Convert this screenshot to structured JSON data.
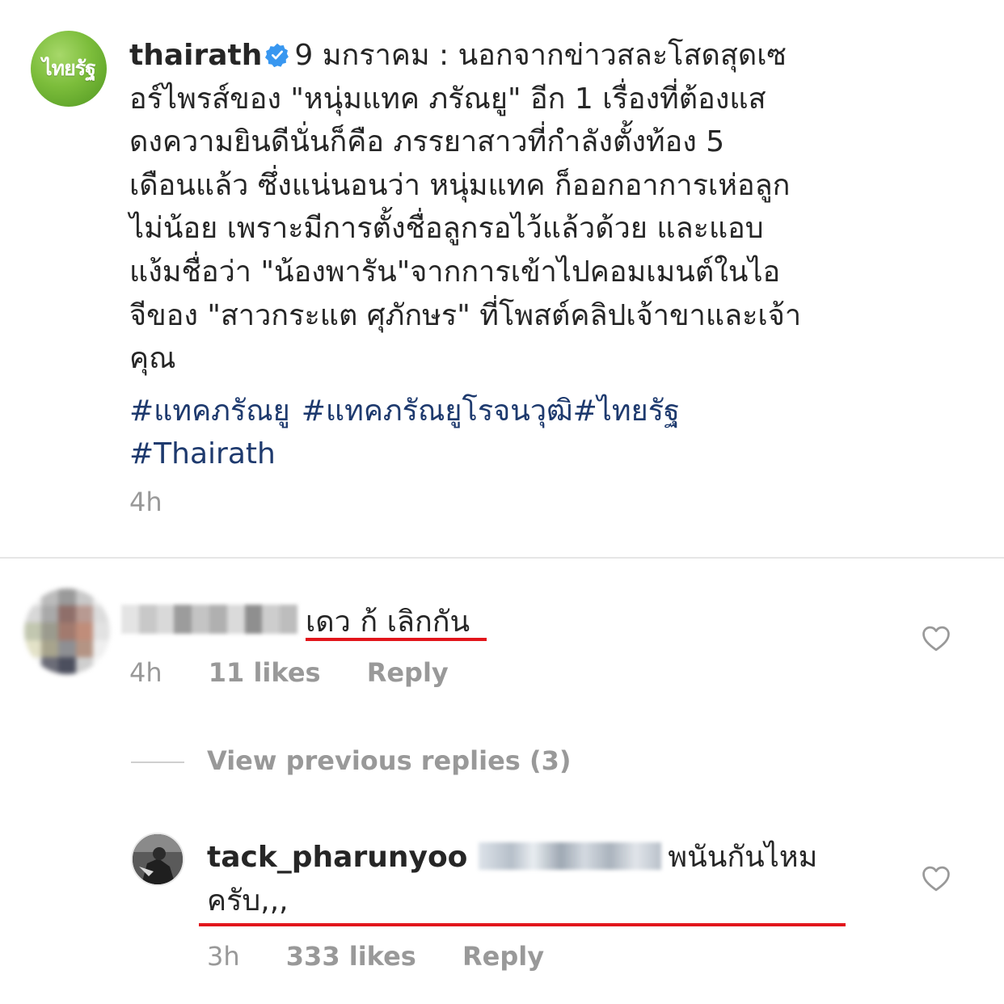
{
  "post": {
    "avatar_logo_text": "ไทยรัฐ",
    "username": "thairath",
    "verified_icon": "verified-badge-icon",
    "caption_lines": [
      "9 มกราคม : นอกจากข่าวสละโสดสุดเซ",
      "อร์ไพรส์ของ \"หนุ่มแทค ภรัณยู\" อีก 1 เรื่องที่ต้องแส",
      "ดงความยินดีนั่นก็คือ ภรรยาสาวที่กำลังตั้งท้อง 5",
      "เดือนแล้ว ซึ่งแน่นอนว่า หนุ่มแทค ก็ออกอาการเห่อลูก",
      "ไม่น้อย เพราะมีการตั้งชื่อลูกรอไว้แล้วด้วย และแอบ",
      "แง้มชื่อว่า \"น้องพารัน\"จากการเข้าไปคอมเมนต์ในไอ",
      "จีของ \"สาวกระแต ศุภักษร\" ที่โพสต์คลิปเจ้าขาและเจ้า",
      "คุณ"
    ],
    "hashtags": [
      "#แทคภรัณยู",
      "#แทคภรัณยูโรจนวุฒิ#ไทยรัฐ",
      "#Thairath"
    ],
    "time": "4h"
  },
  "comment": {
    "text": "เดว ก้ เลิกกัน",
    "time": "4h",
    "likes": "11 likes",
    "reply_label": "Reply",
    "like_icon": "heart-outline-icon"
  },
  "replies": {
    "view_previous": "View previous replies (3)"
  },
  "reply": {
    "username": "tack_pharunyoo",
    "text_line1": "พนันกันไหม",
    "text_line2": "ครับ,,,",
    "time": "3h",
    "likes": "333 likes",
    "reply_label": "Reply",
    "like_icon": "heart-outline-icon"
  },
  "colors": {
    "hashtag": "#1e3a6e",
    "verified": "#3897f0",
    "underline_annotation": "#e2151b",
    "meta_text": "#999999"
  }
}
